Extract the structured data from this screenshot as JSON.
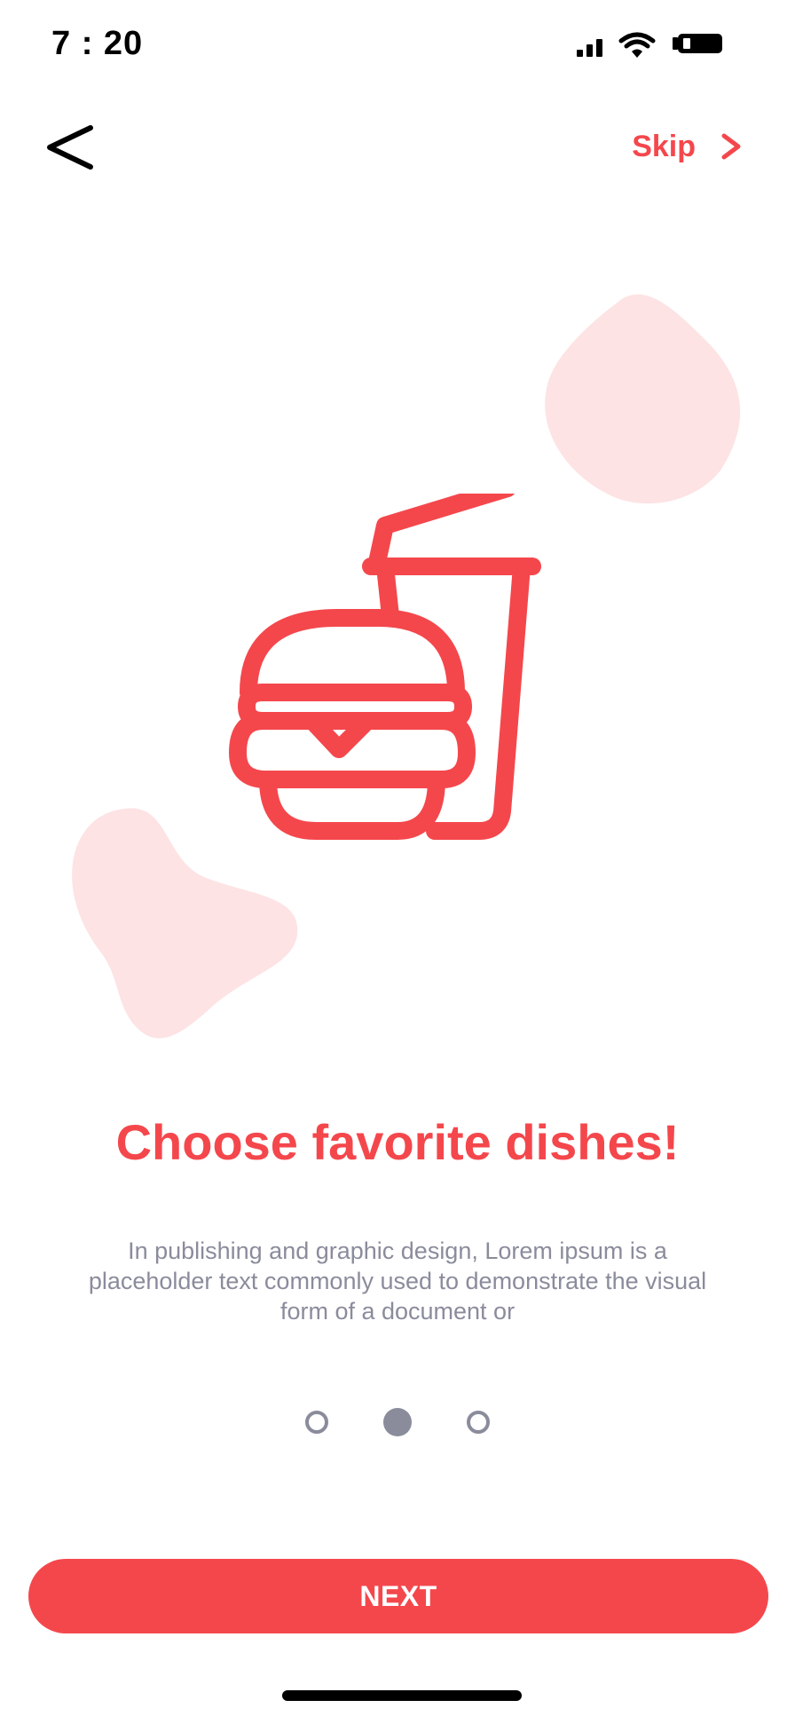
{
  "status_bar": {
    "time": "7 : 20",
    "icons": [
      "signal-icon",
      "wifi-icon",
      "battery-icon"
    ]
  },
  "nav": {
    "back_icon": "chevron-left-icon",
    "skip_label": "Skip",
    "skip_icon": "chevron-right-icon"
  },
  "illustration": {
    "icon": "burger-drink-icon"
  },
  "content": {
    "title": "Choose favorite dishes!",
    "description": "In publishing and graphic design, Lorem ipsum is a placeholder text commonly used to demonstrate the visual form of a document or"
  },
  "pagination": {
    "total": 3,
    "active_index": 1
  },
  "next_button": {
    "label": "NEXT"
  },
  "colors": {
    "accent": "#f4474c",
    "blob": "#fde3e4",
    "muted": "#8a8c9c",
    "text_dark": "#000000"
  }
}
